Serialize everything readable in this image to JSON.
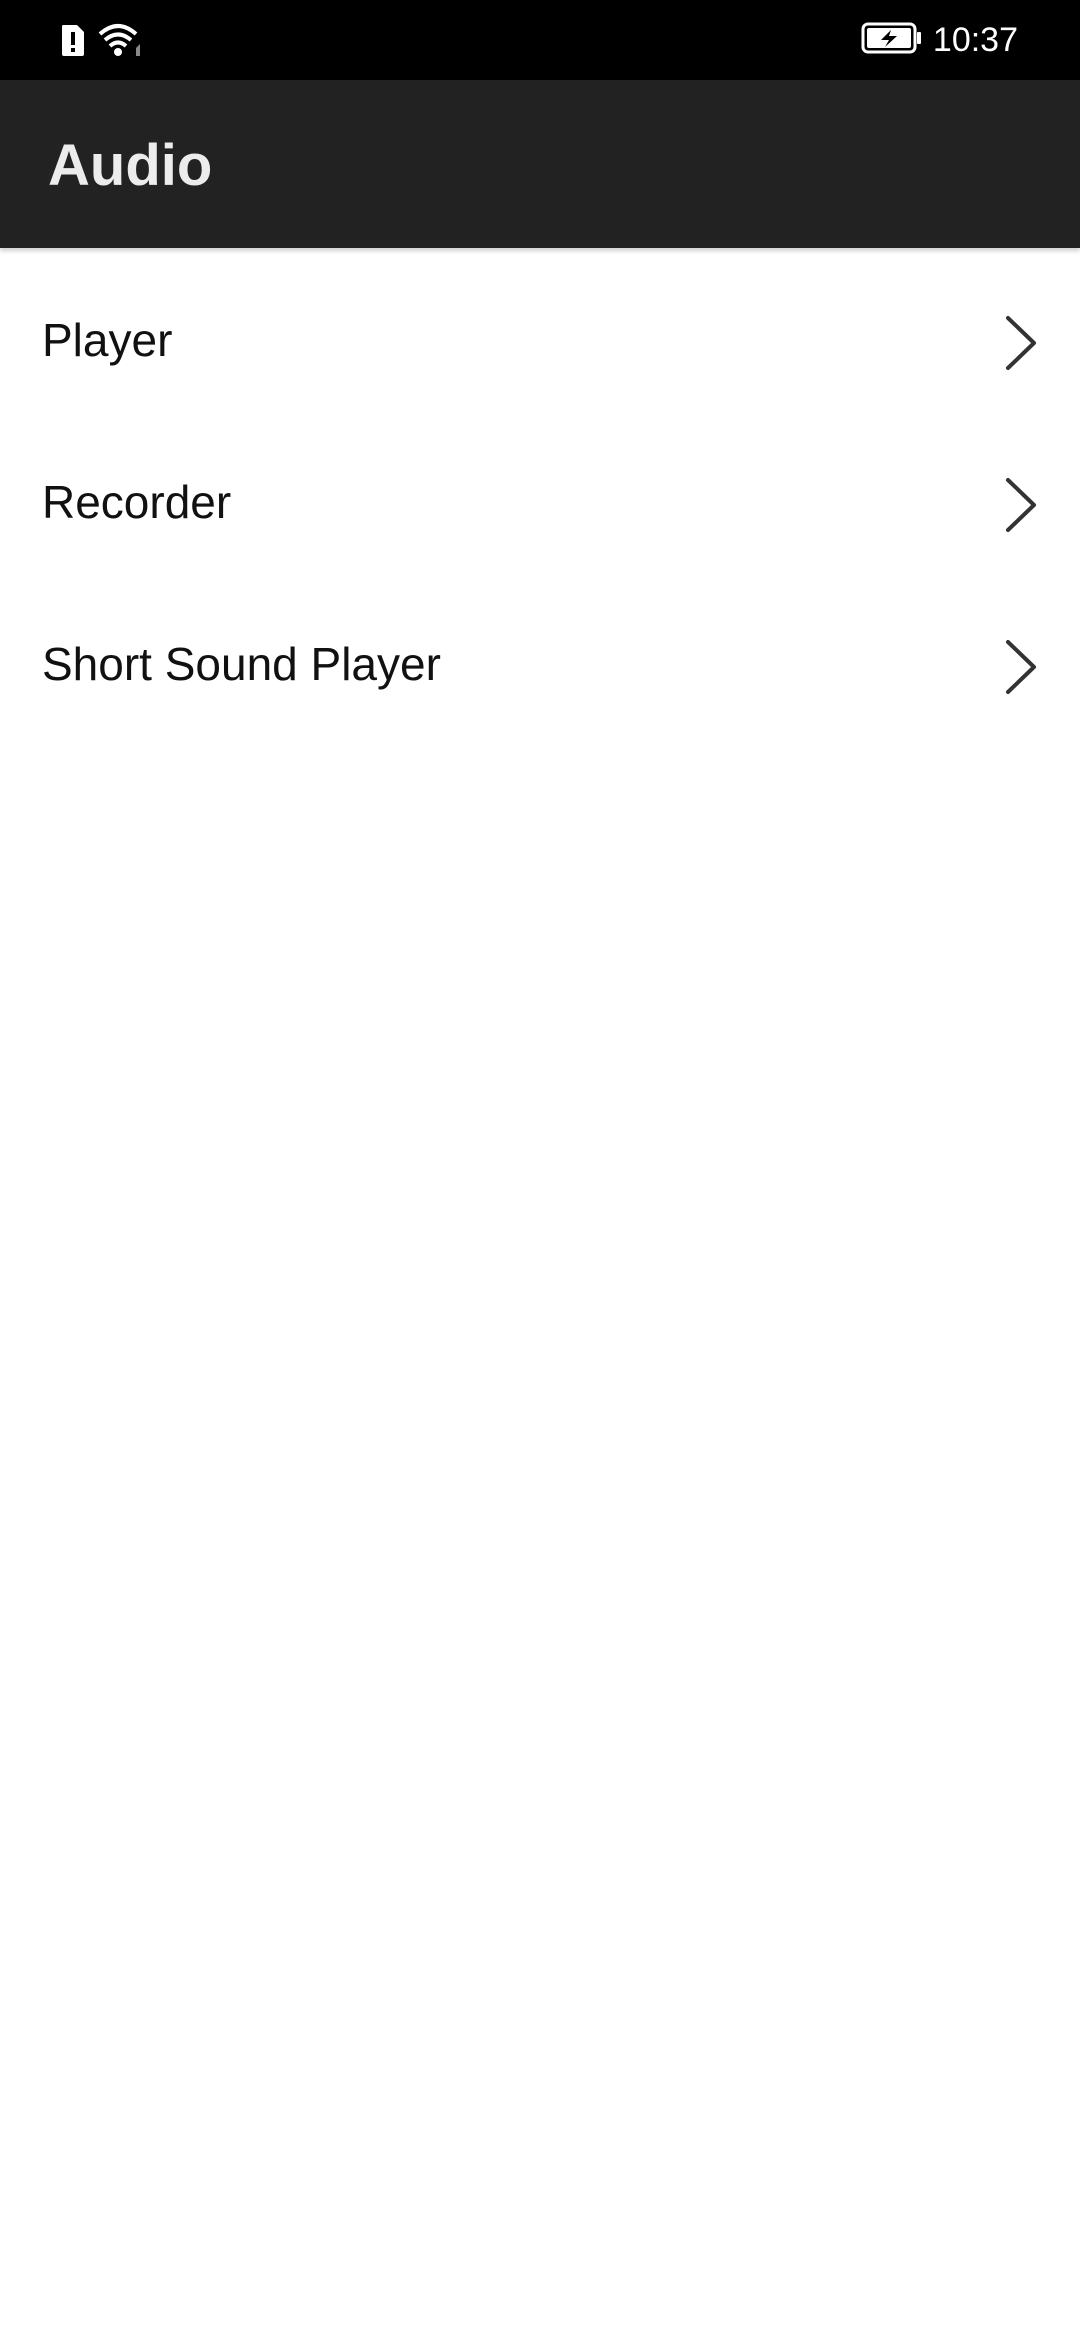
{
  "status_bar": {
    "time": "10:37",
    "icons": [
      "alert-icon",
      "wifi-icon",
      "battery-charging-icon"
    ],
    "background": "#000000"
  },
  "app_bar": {
    "title": "Audio",
    "background": "#222222"
  },
  "menu": {
    "items": [
      {
        "label": "Player",
        "icon": "chevron-right-icon"
      },
      {
        "label": "Recorder",
        "icon": "chevron-right-icon"
      },
      {
        "label": "Short Sound Player",
        "icon": "chevron-right-icon"
      }
    ]
  }
}
